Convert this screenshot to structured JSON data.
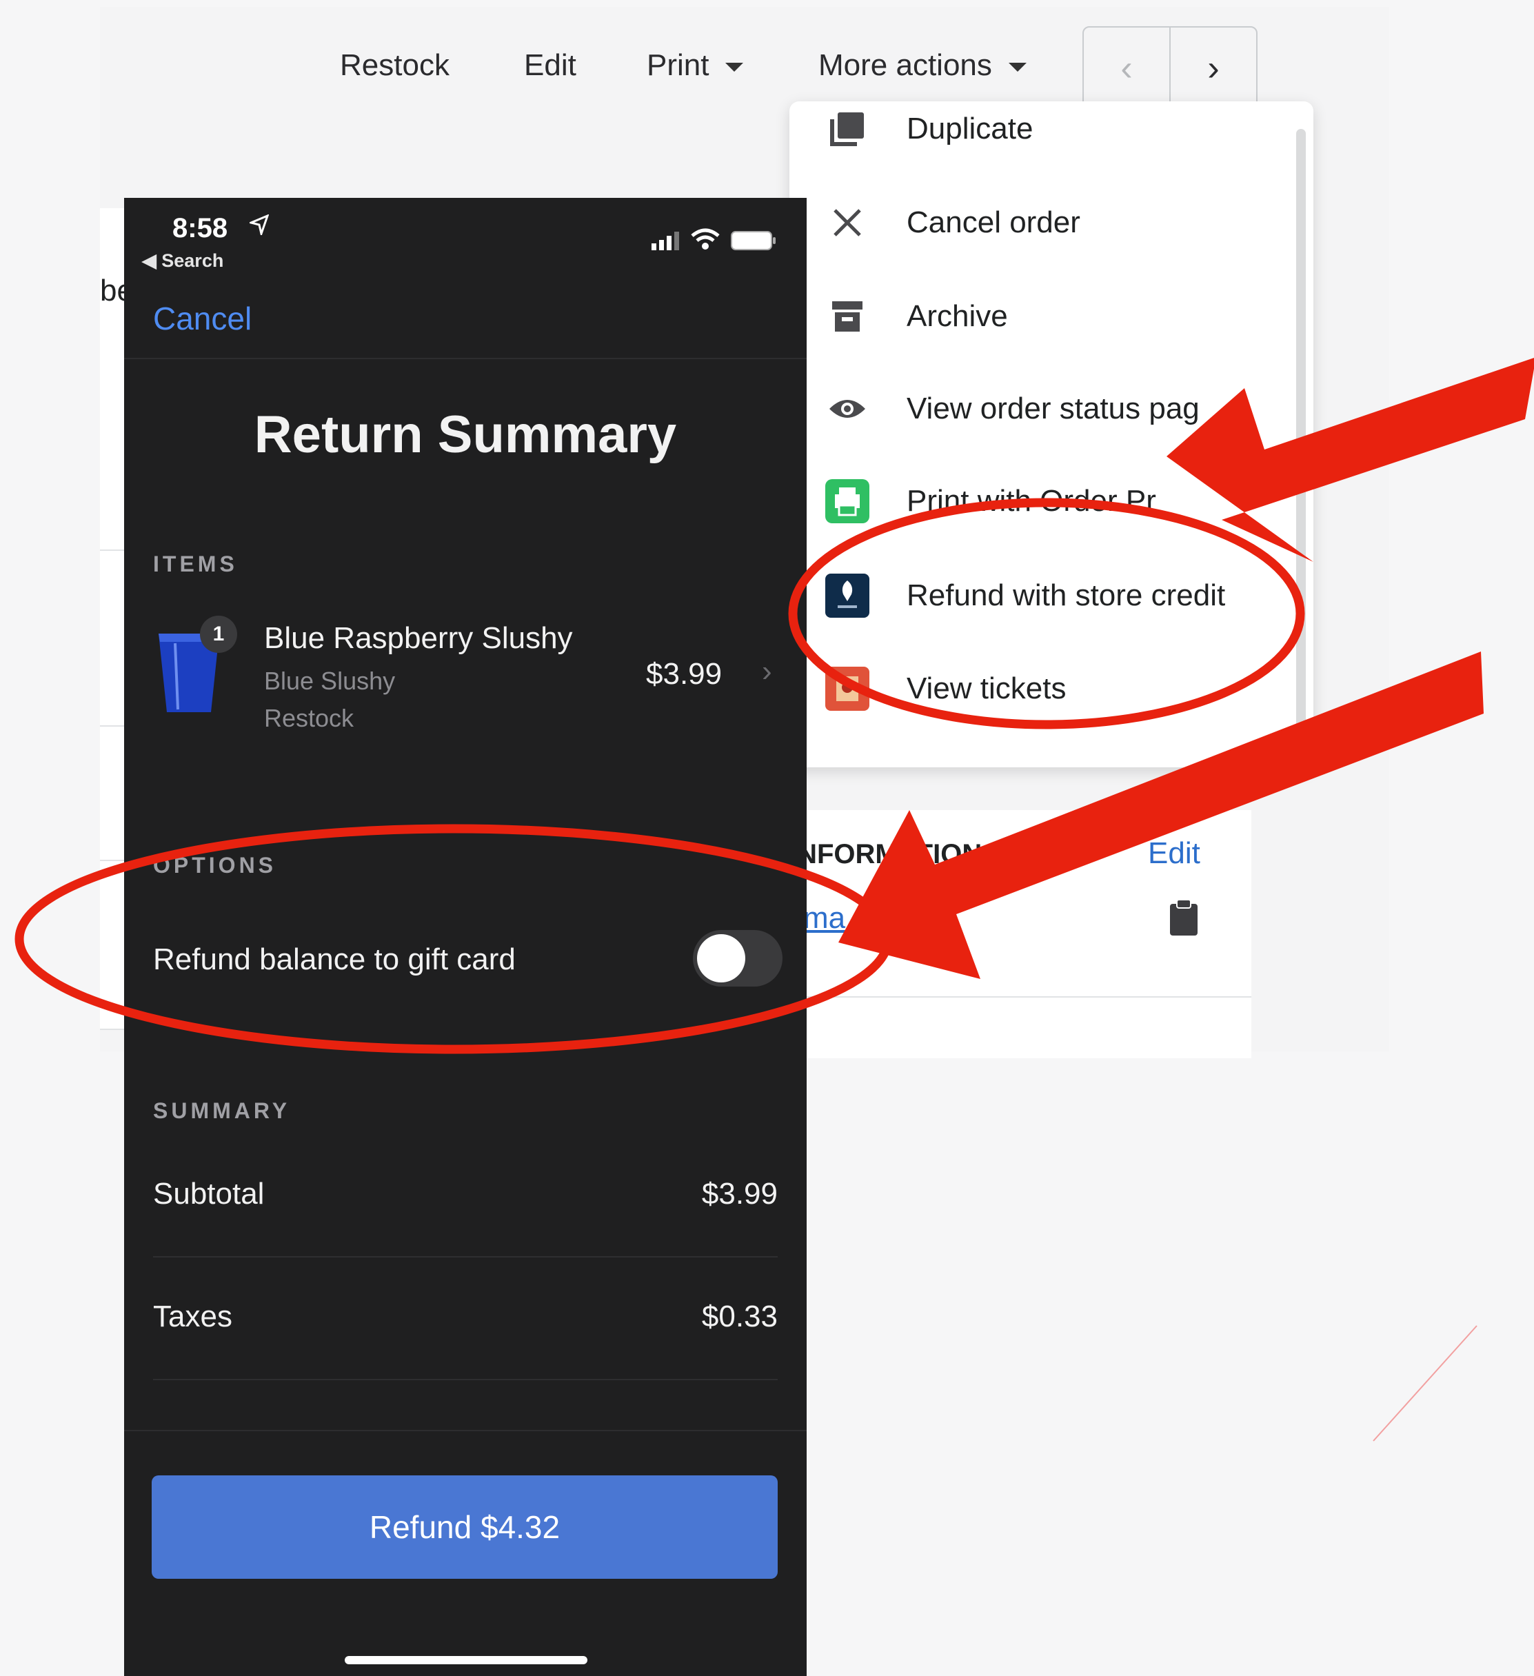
{
  "toolbar": {
    "restock": "Restock",
    "edit": "Edit",
    "print": "Print",
    "more_actions": "More actions"
  },
  "pager": {
    "prev_icon": "chevron-left-icon",
    "next_icon": "chevron-right-icon"
  },
  "left_card": {
    "fragment": "be"
  },
  "more_actions_menu": [
    {
      "label": "Duplicate",
      "icon": "duplicate-icon"
    },
    {
      "label": "Cancel order",
      "icon": "close-icon"
    },
    {
      "label": "Archive",
      "icon": "archive-icon"
    },
    {
      "label": "View order status pag",
      "icon": "eye-icon"
    },
    {
      "label": "Print with Order Pr",
      "icon": "printer-app-icon"
    },
    {
      "label": "Refund with store credit",
      "icon": "store-credit-app-icon"
    },
    {
      "label": "View tickets",
      "icon": "tickets-app-icon"
    }
  ],
  "info_card": {
    "heading": "INFORMATION",
    "edit": "Edit",
    "link": "ma"
  },
  "phone": {
    "status": {
      "time": "8:58",
      "back_label": "◀ Search"
    },
    "cancel": "Cancel",
    "title": "Return Summary",
    "items_heading": "ITEMS",
    "item": {
      "quantity": "1",
      "name": "Blue Raspberry Slushy",
      "variant": "Blue Slushy",
      "action": "Restock",
      "price": "$3.99"
    },
    "options_heading": "OPTIONS",
    "option_label": "Refund balance to gift card",
    "option_enabled": false,
    "summary_heading": "SUMMARY",
    "subtotal_label": "Subtotal",
    "subtotal_value": "$3.99",
    "taxes_label": "Taxes",
    "taxes_value": "$0.33",
    "refund_button": "Refund $4.32"
  },
  "annotation_color": "#e8220f"
}
